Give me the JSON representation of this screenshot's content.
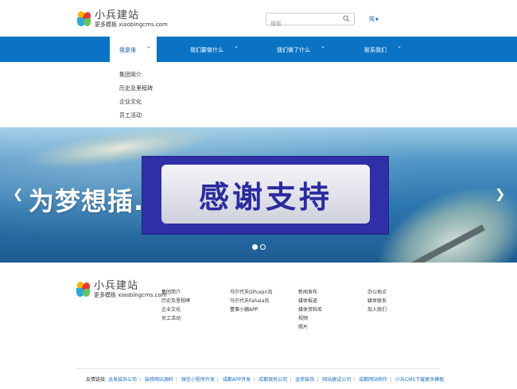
{
  "header": {
    "logo": {
      "title": "小兵建站",
      "subtitle": "更多模板 xiaobingcms.com"
    },
    "search": {
      "placeholder": "搜索"
    },
    "language": "简"
  },
  "nav": {
    "items": [
      {
        "label": "我是谁",
        "active": true
      },
      {
        "label": "我们要做什么",
        "active": false
      },
      {
        "label": "我们做了什么",
        "active": false
      },
      {
        "label": "联系我们",
        "active": false
      }
    ],
    "dropdown": [
      "集团简介",
      "历史及里程碑",
      "企业文化",
      "员工活动"
    ]
  },
  "banner": {
    "headline": "为梦想插...",
    "overlay_text": "感谢支持",
    "slides": 2,
    "active_slide": 1
  },
  "footer": {
    "logo": {
      "title": "小兵建站",
      "subtitle": "更多模板 xiaobingcms.com"
    },
    "columns": [
      [
        "集团简介",
        "历史及里程碑",
        "企业文化",
        "员工活动"
      ],
      [
        "马尔代夫Olhuqiri岛",
        "马尔代夫Fahala岛",
        "董事小棚APP"
      ],
      [
        "新闻发布",
        "媒体报道",
        "媒体资料库",
        "视频",
        "照片"
      ],
      [
        "办公地点",
        "媒体联系",
        "加入我们"
      ]
    ],
    "links_label": "友情链接:",
    "links": [
      "龙发装饰公司",
      "装修网站源码",
      "微信小程序开发",
      "成都APP开发",
      "成都保务公司",
      "金荣装饰",
      "网站建设公司",
      "成都网站制作",
      "小兵CMS下载更多模板"
    ]
  },
  "colors": {
    "nav_blue": "#0a73c4",
    "link_blue": "#1a6fc2",
    "overlay_blue": "#2f2fa8"
  }
}
